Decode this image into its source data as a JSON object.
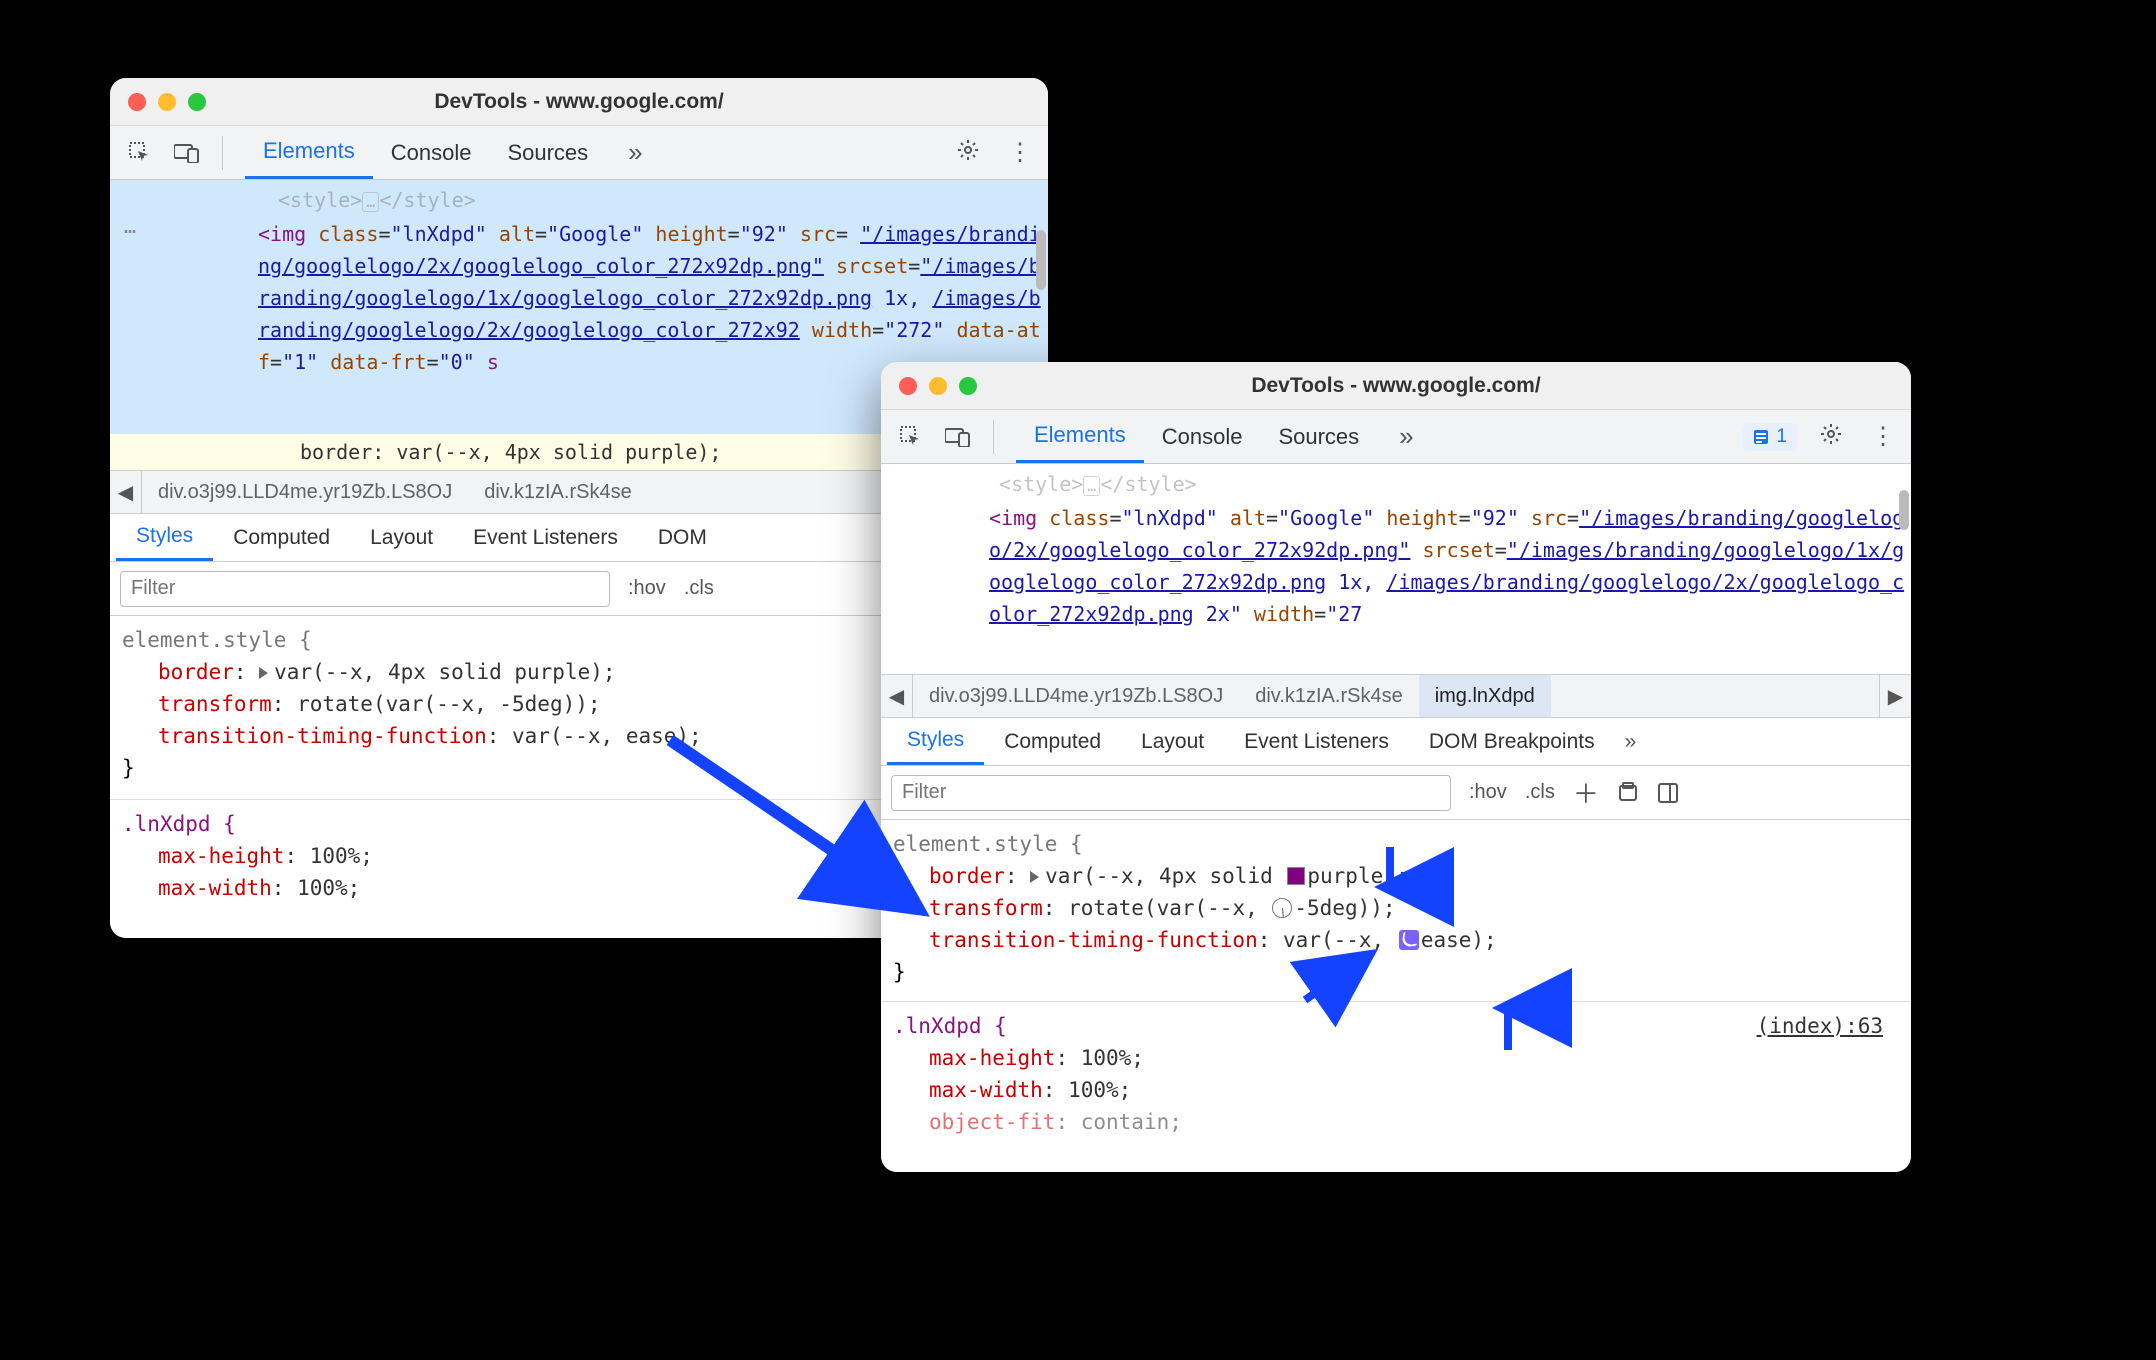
{
  "windows": {
    "w1": {
      "title": "DevTools - www.google.com/",
      "tabs": {
        "elements": "Elements",
        "console": "Console",
        "sources": "Sources"
      },
      "dom": {
        "ellipsis": "…",
        "fadeTop": "<style>…</style>",
        "imgOpen": "<img",
        "classAttr": "class",
        "classVal": "\"lnXdpd\"",
        "altAttr": "alt",
        "altVal": "\"Google\"",
        "heightAttr": "height",
        "heightVal": "\"92\"",
        "srcAttr": "src",
        "srcEq": "=",
        "srcVal1": "\"/images/branding/googlelogo/2x/googlelogo_color_272x92dp.png\"",
        "srcsetAttr": "srcset",
        "srcsetVal1": "\"/images/branding/googlelogo/1x/googlelogo_color_272x92dp.png",
        "srcsetMid": " 1x, ",
        "srcsetVal2": "/images/branding/googlelogo/2x/googlelogo_color_272x92",
        "widthAttr": "width",
        "widthVal": "\"272\"",
        "atfAttr": "data-atf",
        "atfVal": "\"1\"",
        "frtAttr": "data-frt",
        "frtVal": "\"0\"",
        "overlay": "border: var(--x, 4px solid purple);"
      },
      "crumbs": {
        "c1": "div.o3j99.LLD4me.yr19Zb.LS8OJ",
        "c2": "div.k1zIA.rSk4se"
      },
      "subtabs": {
        "styles": "Styles",
        "computed": "Computed",
        "layout": "Layout",
        "ev": "Event Listeners",
        "dom": "DOM "
      },
      "filter": {
        "placeholder": "Filter",
        "hov": ":hov",
        "cls": ".cls"
      },
      "styles": {
        "sel1": "element.style {",
        "p_border": "border",
        "v_border": "var(--x, 4px solid purple);",
        "p_transform": "transform",
        "v_transform": "rotate(var(--x, -5deg));",
        "p_ttf": "transition-timing-function",
        "v_ttf": "var(--x, ease);",
        "close1": "}",
        "sel2": ".lnXdpd {",
        "p_mh": "max-height",
        "v_mh": "100%;",
        "p_mw": "max-width",
        "v_mw": "100%;"
      }
    },
    "w2": {
      "title": "DevTools - www.google.com/",
      "tabs": {
        "elements": "Elements",
        "console": "Console",
        "sources": "Sources"
      },
      "issues": {
        "count": "1"
      },
      "dom": {
        "fadeTop": "<style>…</style>",
        "imgOpen": "<img",
        "classAttr": "class",
        "classVal": "\"lnXdpd\"",
        "altAttr": "alt",
        "altVal": "\"Google\"",
        "heightAttr": "height",
        "heightVal": "\"92\"",
        "srcAttr": "src",
        "srcVal": "\"/images/branding/googlelogo/2x/googlelogo_color_272x92dp.png\"",
        "srcsetAttr": "srcset",
        "srcset1": "\"/images/branding/googlelogo/1x/googlelogo_color_272x92dp.png",
        "srcsetMid": " 1x, ",
        "srcset2": "/images/branding/googlelogo/2x/googlelogo_color_272x92dp.png",
        "srcsetTail": " 2x\"",
        "widthAttr": "width",
        "widthVal": "\"27"
      },
      "crumbs": {
        "c1": "div.o3j99.LLD4me.yr19Zb.LS8OJ",
        "c2": "div.k1zIA.rSk4se",
        "c3": "img.lnXdpd"
      },
      "subtabs": {
        "styles": "Styles",
        "computed": "Computed",
        "layout": "Layout",
        "ev": "Event Listeners",
        "dbp": "DOM Breakpoints"
      },
      "filter": {
        "placeholder": "Filter",
        "hov": ":hov",
        "cls": ".cls"
      },
      "styles": {
        "sel1": "element.style {",
        "p_border": "border",
        "v_border_pre": "var(--x, 4px solid ",
        "v_border_post": "purple);",
        "p_transform": "transform",
        "v_trans_pre": "rotate(var(--x, ",
        "v_trans_post": "-5deg));",
        "p_ttf": "transition-timing-function",
        "v_ttf_pre": "var(--x, ",
        "v_ttf_post": "ease);",
        "close1": "}",
        "sel2": ".lnXdpd {",
        "p_mh": "max-height",
        "v_mh": "100%;",
        "p_mw": "max-width",
        "v_mw": "100%;",
        "p_of": "object-fit",
        "v_of": "contain;",
        "idx": "(index):63"
      }
    }
  }
}
